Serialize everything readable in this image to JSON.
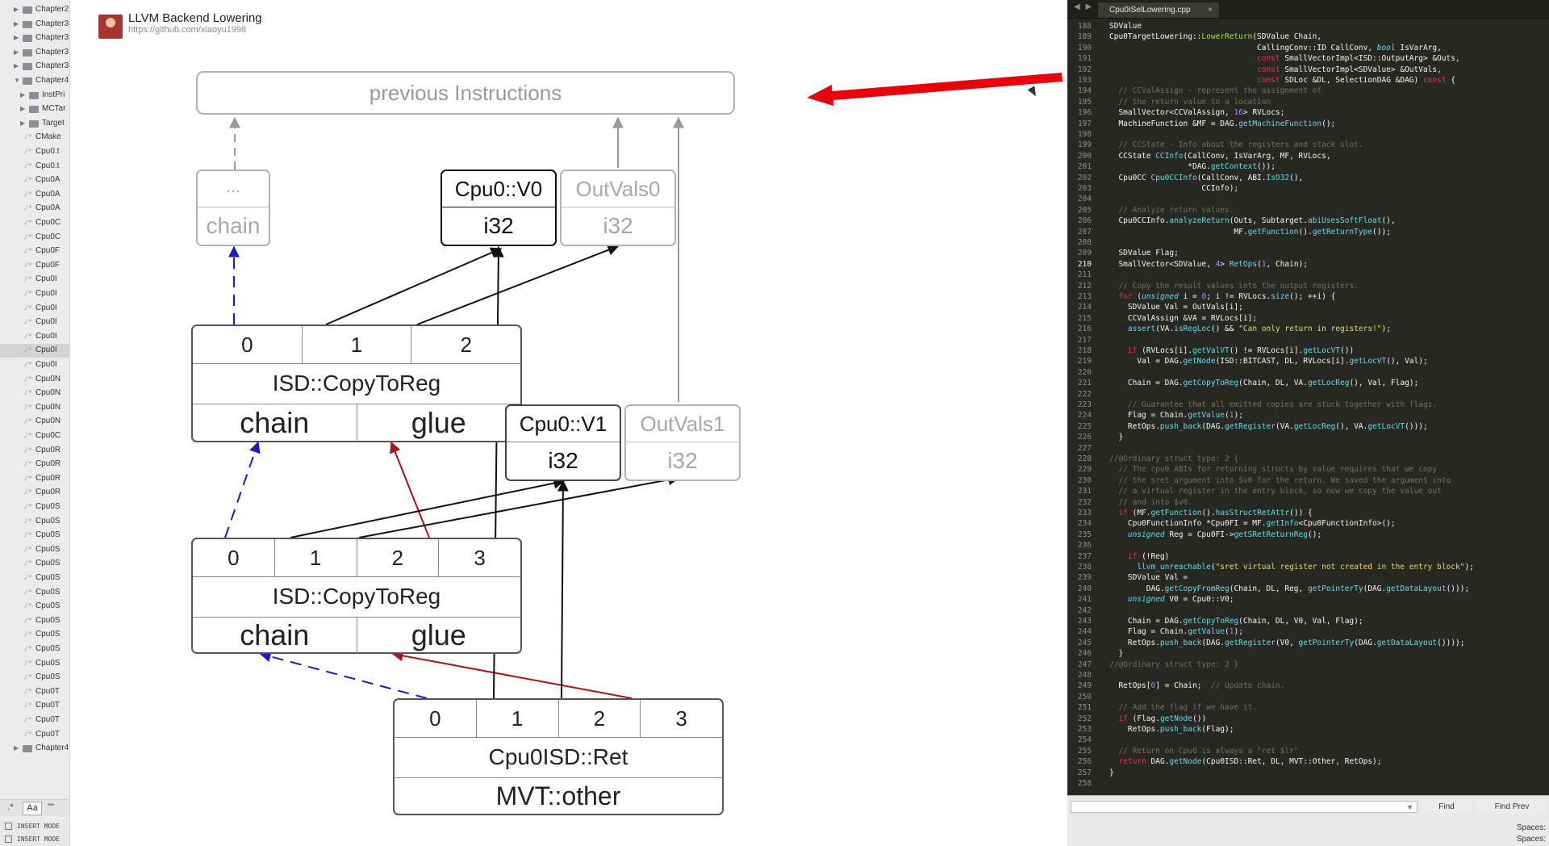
{
  "sidebar": {
    "items": [
      {
        "kind": "folder",
        "label": "Chapter2",
        "arrow": "▶"
      },
      {
        "kind": "folder",
        "label": "Chapter3",
        "arrow": "▶"
      },
      {
        "kind": "folder",
        "label": "Chapter3",
        "arrow": "▶"
      },
      {
        "kind": "folder",
        "label": "Chapter3",
        "arrow": "▶"
      },
      {
        "kind": "folder",
        "label": "Chapter3",
        "arrow": "▶"
      },
      {
        "kind": "folder",
        "label": "Chapter4",
        "arrow": "▼"
      },
      {
        "kind": "folder",
        "label": "InstPri",
        "arrow": "▶"
      },
      {
        "kind": "folder",
        "label": "MCTar",
        "arrow": "▶"
      },
      {
        "kind": "folder",
        "label": "Target",
        "arrow": "▶"
      },
      {
        "kind": "file",
        "label": "CMake"
      },
      {
        "kind": "file",
        "label": "Cpu0.t"
      },
      {
        "kind": "file",
        "label": "Cpu0.t"
      },
      {
        "kind": "file",
        "label": "Cpu0A"
      },
      {
        "kind": "file",
        "label": "Cpu0A"
      },
      {
        "kind": "file",
        "label": "Cpu0A"
      },
      {
        "kind": "file",
        "label": "Cpu0C"
      },
      {
        "kind": "file",
        "label": "Cpu0C"
      },
      {
        "kind": "file",
        "label": "Cpu0F"
      },
      {
        "kind": "file",
        "label": "Cpu0F"
      },
      {
        "kind": "file",
        "label": "Cpu0I"
      },
      {
        "kind": "file",
        "label": "Cpu0I"
      },
      {
        "kind": "file",
        "label": "Cpu0I"
      },
      {
        "kind": "file",
        "label": "Cpu0I"
      },
      {
        "kind": "file",
        "label": "Cpu0I"
      },
      {
        "kind": "file",
        "label": "Cpu0I",
        "selected": true
      },
      {
        "kind": "file",
        "label": "Cpu0I"
      },
      {
        "kind": "file",
        "label": "Cpu0N"
      },
      {
        "kind": "file",
        "label": "Cpu0N"
      },
      {
        "kind": "file",
        "label": "Cpu0N"
      },
      {
        "kind": "file",
        "label": "Cpu0N"
      },
      {
        "kind": "file",
        "label": "Cpu0C"
      },
      {
        "kind": "file",
        "label": "Cpu0R"
      },
      {
        "kind": "file",
        "label": "Cpu0R"
      },
      {
        "kind": "file",
        "label": "Cpu0R"
      },
      {
        "kind": "file",
        "label": "Cpu0R"
      },
      {
        "kind": "file",
        "label": "Cpu0S"
      },
      {
        "kind": "file",
        "label": "Cpu0S"
      },
      {
        "kind": "file",
        "label": "Cpu0S"
      },
      {
        "kind": "file",
        "label": "Cpu0S"
      },
      {
        "kind": "file",
        "label": "Cpu0S"
      },
      {
        "kind": "file",
        "label": "Cpu0S"
      },
      {
        "kind": "file",
        "label": "Cpu0S"
      },
      {
        "kind": "file",
        "label": "Cpu0S"
      },
      {
        "kind": "file",
        "label": "Cpu0S"
      },
      {
        "kind": "file",
        "label": "Cpu0S"
      },
      {
        "kind": "file",
        "label": "Cpu0S"
      },
      {
        "kind": "file",
        "label": "Cpu0S"
      },
      {
        "kind": "file",
        "label": "Cpu0S"
      },
      {
        "kind": "file",
        "label": "Cpu0T"
      },
      {
        "kind": "file",
        "label": "Cpu0T"
      },
      {
        "kind": "file",
        "label": "Cpu0T"
      },
      {
        "kind": "file",
        "label": "Cpu0T"
      },
      {
        "kind": "folder",
        "label": "Chapter4",
        "arrow": "▶"
      }
    ],
    "bottom": {
      "regex": ".*",
      "case": "Aa",
      "word": "\"\""
    },
    "status": [
      "INSERT MODE",
      "INSERT MODE"
    ]
  },
  "header": {
    "title": "LLVM Backend Lowering",
    "url": "https://github.com/xiaoyu1998"
  },
  "diagram": {
    "prev": "previous Instructions",
    "chainNode": {
      "top": "...",
      "bottom": "chain"
    },
    "v0": {
      "top": "Cpu0::V0",
      "bottom": "i32"
    },
    "outvals0": {
      "top": "OutVals0",
      "bottom": "i32"
    },
    "v1": {
      "top": "Cpu0::V1",
      "bottom": "i32"
    },
    "outvals1": {
      "top": "OutVals1",
      "bottom": "i32"
    },
    "copy1": {
      "ops": [
        "0",
        "1",
        "2"
      ],
      "name": "ISD::CopyToReg",
      "res": [
        "chain",
        "glue"
      ]
    },
    "copy2": {
      "ops": [
        "0",
        "1",
        "2",
        "3"
      ],
      "name": "ISD::CopyToReg",
      "res": [
        "chain",
        "glue"
      ]
    },
    "ret": {
      "ops": [
        "0",
        "1",
        "2",
        "3"
      ],
      "name": "Cpu0ISD::Ret",
      "res": "MVT::other"
    }
  },
  "colors": {
    "chainEdge": "#1a1ac8",
    "glueEdge": "#b0101a",
    "pointer": "#e8000d",
    "editorBg": "#272822"
  },
  "editor": {
    "tabName": "Cpu0ISelLowering.cpp",
    "tabNav": "◀ ▶",
    "close": "×",
    "currentLine": 210,
    "lines": [
      {
        "n": 188,
        "h": "SDValue"
      },
      {
        "n": 189,
        "h": "Cpu0TargetLowering::<span class=\"y\">LowerReturn</span>(SDValue Chain,"
      },
      {
        "n": 190,
        "h": "                                CallingConv::ID CallConv, <span class=\"t\">bool</span> IsVarArg,"
      },
      {
        "n": 191,
        "h": "                                <span class=\"k\">const</span> SmallVectorImpl&lt;ISD::OutputArg&gt; &amp;Outs,"
      },
      {
        "n": 192,
        "h": "                                <span class=\"k\">const</span> SmallVectorImpl&lt;SDValue&gt; &amp;OutVals,"
      },
      {
        "n": 193,
        "h": "                                <span class=\"k\">const</span> SDLoc &amp;DL, SelectionDAG &amp;DAG) <span class=\"k\">const</span> {"
      },
      {
        "n": 194,
        "h": "  <span class=\"c\">// CCValAssign - represent the assignment of</span>"
      },
      {
        "n": 195,
        "h": "  <span class=\"c\">// the return value to a location</span>"
      },
      {
        "n": 196,
        "h": "  SmallVector&lt;CCValAssign, <span class=\"n\">16</span>&gt; RVLocs;"
      },
      {
        "n": 197,
        "h": "  MachineFunction &amp;MF = DAG.<span class=\"f\">getMachineFunction</span>();"
      },
      {
        "n": 198,
        "h": ""
      },
      {
        "n": 199,
        "h": "  <span class=\"c\">// CCState - Info about the registers and stack slot.</span>"
      },
      {
        "n": 200,
        "h": "  CCState <span class=\"f\">CCInfo</span>(CallConv, IsVarArg, MF, RVLocs,"
      },
      {
        "n": 201,
        "h": "                 *DAG.<span class=\"f\">getContext</span>());"
      },
      {
        "n": 202,
        "h": "  Cpu0CC <span class=\"f\">Cpu0CCInfo</span>(CallConv, ABI.<span class=\"f\">IsO32</span>(),"
      },
      {
        "n": 203,
        "h": "                    CCInfo);"
      },
      {
        "n": 204,
        "h": ""
      },
      {
        "n": 205,
        "h": "  <span class=\"c\">// Analyze return values.</span>"
      },
      {
        "n": 206,
        "h": "  Cpu0CCInfo.<span class=\"f\">analyzeReturn</span>(Outs, Subtarget.<span class=\"f\">abiUsesSoftFloat</span>(),"
      },
      {
        "n": 207,
        "h": "                           MF.<span class=\"f\">getFunction</span>().<span class=\"f\">getReturnType</span>());"
      },
      {
        "n": 208,
        "h": ""
      },
      {
        "n": 209,
        "h": "  SDValue Flag;"
      },
      {
        "n": 210,
        "h": "  SmallVector&lt;SDValue, <span class=\"n\">4</span>&gt; <span class=\"f\">RetOps</span>(<span class=\"n\">1</span>, Chain);"
      },
      {
        "n": 211,
        "h": ""
      },
      {
        "n": 212,
        "h": "  <span class=\"c\">// Copy the result values into the output registers.</span>"
      },
      {
        "n": 213,
        "h": "  <span class=\"k\">for</span> (<span class=\"t\">unsigned</span> i = <span class=\"n\">0</span>; i != RVLocs.<span class=\"f\">size</span>(); ++i) {"
      },
      {
        "n": 214,
        "h": "    SDValue Val = OutVals[i];"
      },
      {
        "n": 215,
        "h": "    CCValAssign &amp;VA = RVLocs[i];"
      },
      {
        "n": 216,
        "h": "    <span class=\"f\">assert</span>(VA.<span class=\"f\">isRegLoc</span>() &amp;&amp; <span class=\"s\">\"Can only return in registers!\"</span>);"
      },
      {
        "n": 217,
        "h": ""
      },
      {
        "n": 218,
        "h": "    <span class=\"k\">if</span> (RVLocs[i].<span class=\"f\">getValVT</span>() != RVLocs[i].<span class=\"f\">getLocVT</span>())"
      },
      {
        "n": 219,
        "h": "      Val = DAG.<span class=\"f\">getNode</span>(ISD::BITCAST, DL, RVLocs[i].<span class=\"f\">getLocVT</span>(), Val);"
      },
      {
        "n": 220,
        "h": ""
      },
      {
        "n": 221,
        "h": "    Chain = DAG.<span class=\"f\">getCopyToReg</span>(Chain, DL, VA.<span class=\"f\">getLocReg</span>(), Val, Flag);"
      },
      {
        "n": 222,
        "h": ""
      },
      {
        "n": 223,
        "h": "    <span class=\"c\">// Guarantee that all emitted copies are stuck together with flags.</span>"
      },
      {
        "n": 224,
        "h": "    Flag = Chain.<span class=\"f\">getValue</span>(<span class=\"n\">1</span>);"
      },
      {
        "n": 225,
        "h": "    RetOps.<span class=\"f\">push_back</span>(DAG.<span class=\"f\">getRegister</span>(VA.<span class=\"f\">getLocReg</span>(), VA.<span class=\"f\">getLocVT</span>()));"
      },
      {
        "n": 226,
        "h": "  }"
      },
      {
        "n": 227,
        "h": ""
      },
      {
        "n": 228,
        "h": "<span class=\"c\">//@Ordinary struct type: 2 {</span>"
      },
      {
        "n": 229,
        "h": "  <span class=\"c\">// The cpu0 ABIs for returning structs by value requires that we copy</span>"
      },
      {
        "n": 230,
        "h": "  <span class=\"c\">// the sret argument into $v0 for the return. We saved the argument into</span>"
      },
      {
        "n": 231,
        "h": "  <span class=\"c\">// a virtual register in the entry block, so now we copy the value out</span>"
      },
      {
        "n": 232,
        "h": "  <span class=\"c\">// and into $v0.</span>"
      },
      {
        "n": 233,
        "h": "  <span class=\"k\">if</span> (MF.<span class=\"f\">getFunction</span>().<span class=\"f\">hasStructRetAttr</span>()) {"
      },
      {
        "n": 234,
        "h": "    Cpu0FunctionInfo *Cpu0FI = MF.<span class=\"f\">getInfo</span>&lt;Cpu0FunctionInfo&gt;();"
      },
      {
        "n": 235,
        "h": "    <span class=\"t\">unsigned</span> Reg = Cpu0FI-&gt;<span class=\"f\">getSRetReturnReg</span>();"
      },
      {
        "n": 236,
        "h": ""
      },
      {
        "n": 237,
        "h": "    <span class=\"k\">if</span> (!Reg)"
      },
      {
        "n": 238,
        "h": "      <span class=\"f\">llvm_unreachable</span>(<span class=\"s\">\"sret virtual register not created in the entry block\"</span>);"
      },
      {
        "n": 239,
        "h": "    SDValue Val ="
      },
      {
        "n": 240,
        "h": "        DAG.<span class=\"f\">getCopyFromReg</span>(Chain, DL, Reg, <span class=\"f\">getPointerTy</span>(DAG.<span class=\"f\">getDataLayout</span>()));"
      },
      {
        "n": 241,
        "h": "    <span class=\"t\">unsigned</span> V0 = Cpu0::V0;"
      },
      {
        "n": 242,
        "h": ""
      },
      {
        "n": 243,
        "h": "    Chain = DAG.<span class=\"f\">getCopyToReg</span>(Chain, DL, V0, Val, Flag);"
      },
      {
        "n": 244,
        "h": "    Flag = Chain.<span class=\"f\">getValue</span>(<span class=\"n\">1</span>);"
      },
      {
        "n": 245,
        "h": "    RetOps.<span class=\"f\">push_back</span>(DAG.<span class=\"f\">getRegister</span>(V0, <span class=\"f\">getPointerTy</span>(DAG.<span class=\"f\">getDataLayout</span>())));"
      },
      {
        "n": 246,
        "h": "  }"
      },
      {
        "n": 247,
        "h": "<span class=\"c\">//@Ordinary struct type: 2 }</span>"
      },
      {
        "n": 248,
        "h": ""
      },
      {
        "n": 249,
        "h": "  RetOps[<span class=\"n\">0</span>] = Chain;  <span class=\"c\">// Update chain.</span>"
      },
      {
        "n": 250,
        "h": ""
      },
      {
        "n": 251,
        "h": "  <span class=\"c\">// Add the flag if we have it.</span>"
      },
      {
        "n": 252,
        "h": "  <span class=\"k\">if</span> (Flag.<span class=\"f\">getNode</span>())"
      },
      {
        "n": 253,
        "h": "    RetOps.<span class=\"f\">push_back</span>(Flag);"
      },
      {
        "n": 254,
        "h": ""
      },
      {
        "n": 255,
        "h": "  <span class=\"c\">// Return on Cpu0 is always a \"ret $lr\"</span>"
      },
      {
        "n": 256,
        "h": "  <span class=\"k\">return</span> DAG.<span class=\"f\">getNode</span>(Cpu0ISD::Ret, DL, MVT::Other, RetOps);"
      },
      {
        "n": 257,
        "h": "}"
      },
      {
        "n": 258,
        "h": ""
      }
    ]
  },
  "findbar": {
    "dropdown": "▼",
    "find": "Find",
    "findPrev": "Find Prev",
    "status1": "Spaces:",
    "status2": "Spaces:"
  }
}
